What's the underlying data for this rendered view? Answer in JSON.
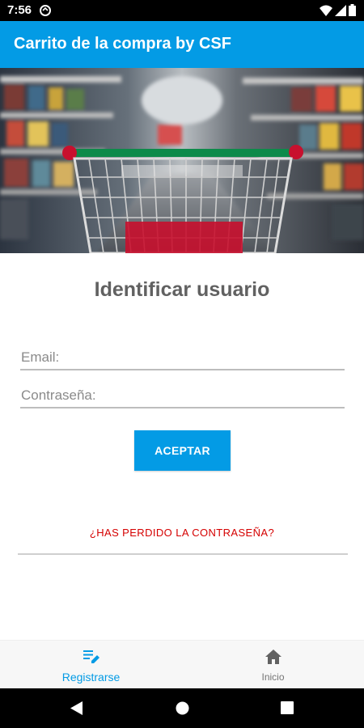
{
  "status_bar": {
    "time": "7:56",
    "icons": [
      "data-saver-icon",
      "wifi-icon",
      "cellular-icon",
      "battery-icon"
    ]
  },
  "app_bar": {
    "title": "Carrito de la compra by CSF",
    "background_color": "#039be5"
  },
  "hero": {
    "image": "shopping-cart-in-supermarket-aisle"
  },
  "login": {
    "title": "Identificar usuario",
    "email_placeholder": "Email:",
    "email_value": "",
    "password_placeholder": "Contraseña:",
    "password_value": "",
    "accept_label": "ACEPTAR",
    "forgot_password_label": "¿HAS PERDIDO LA CONTRASEÑA?",
    "forgot_password_color": "#d50000"
  },
  "bottom_nav": {
    "items": [
      {
        "label": "Registrarse",
        "icon": "edit-list-icon",
        "selected": true
      },
      {
        "label": "Inicio",
        "icon": "home-icon",
        "selected": false
      }
    ],
    "selected_color": "#039be5"
  },
  "system_nav": {
    "buttons": [
      "back-icon",
      "home-circle-icon",
      "recents-icon"
    ]
  }
}
